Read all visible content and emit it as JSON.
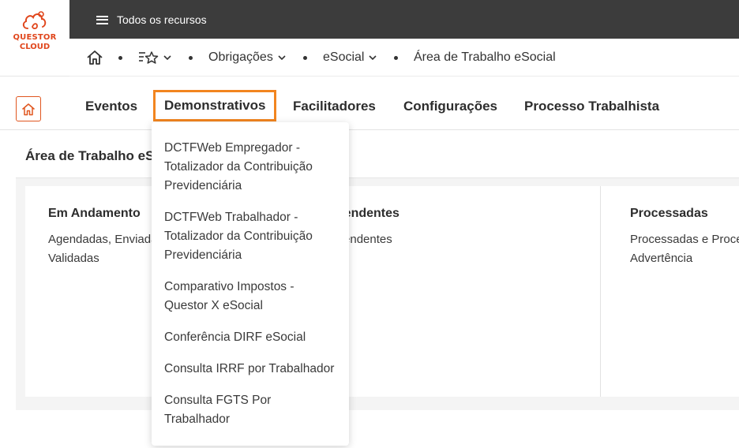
{
  "logo": {
    "line1": "QUESTOR",
    "line2": "CLOUD",
    "brand_color": "#e0461c"
  },
  "topbar": {
    "menu_label": "Todos os recursos",
    "menu_icon": "hamburger-icon",
    "background": "#3c3c3c"
  },
  "breadcrumb": {
    "home_icon": "home-icon",
    "favorites_icon": "star-list-icon",
    "items": [
      {
        "label": "Obrigações"
      },
      {
        "label": "eSocial"
      },
      {
        "label": "Área de Trabalho eSocial"
      }
    ]
  },
  "tabs": {
    "home_icon": "home-icon",
    "accent": "#f2851f",
    "items": [
      {
        "label": "Eventos"
      },
      {
        "label": "Demonstrativos"
      },
      {
        "label": "Facilitadores"
      },
      {
        "label": "Configurações"
      },
      {
        "label": "Processo Trabalhista"
      }
    ],
    "active": "Demonstrativos"
  },
  "panel": {
    "title": "Área de Trabalho eSocial",
    "columns": [
      {
        "title": "Em Andamento",
        "lines": [
          "Agendadas, Enviadas,",
          "Validadas"
        ]
      },
      {
        "title": "Pendentes",
        "lines": [
          "Pendentes"
        ]
      },
      {
        "title": "Processadas",
        "lines": [
          "Processadas e Processadas com",
          "Advertência"
        ]
      }
    ]
  },
  "dropdown": {
    "items": [
      {
        "lines": [
          "DCTFWeb Empregador -",
          "Totalizador da Contribuição",
          "Previdenciária"
        ]
      },
      {
        "lines": [
          "DCTFWeb Trabalhador -",
          "Totalizador da Contribuição",
          "Previdenciária"
        ]
      },
      {
        "lines": [
          "Comparativo Impostos -",
          "Questor X eSocial"
        ]
      },
      {
        "lines": [
          "Conferência DIRF eSocial"
        ]
      },
      {
        "lines": [
          "Consulta IRRF por Trabalhador"
        ]
      },
      {
        "lines": [
          "Consulta FGTS Por",
          "Trabalhador"
        ]
      }
    ]
  }
}
